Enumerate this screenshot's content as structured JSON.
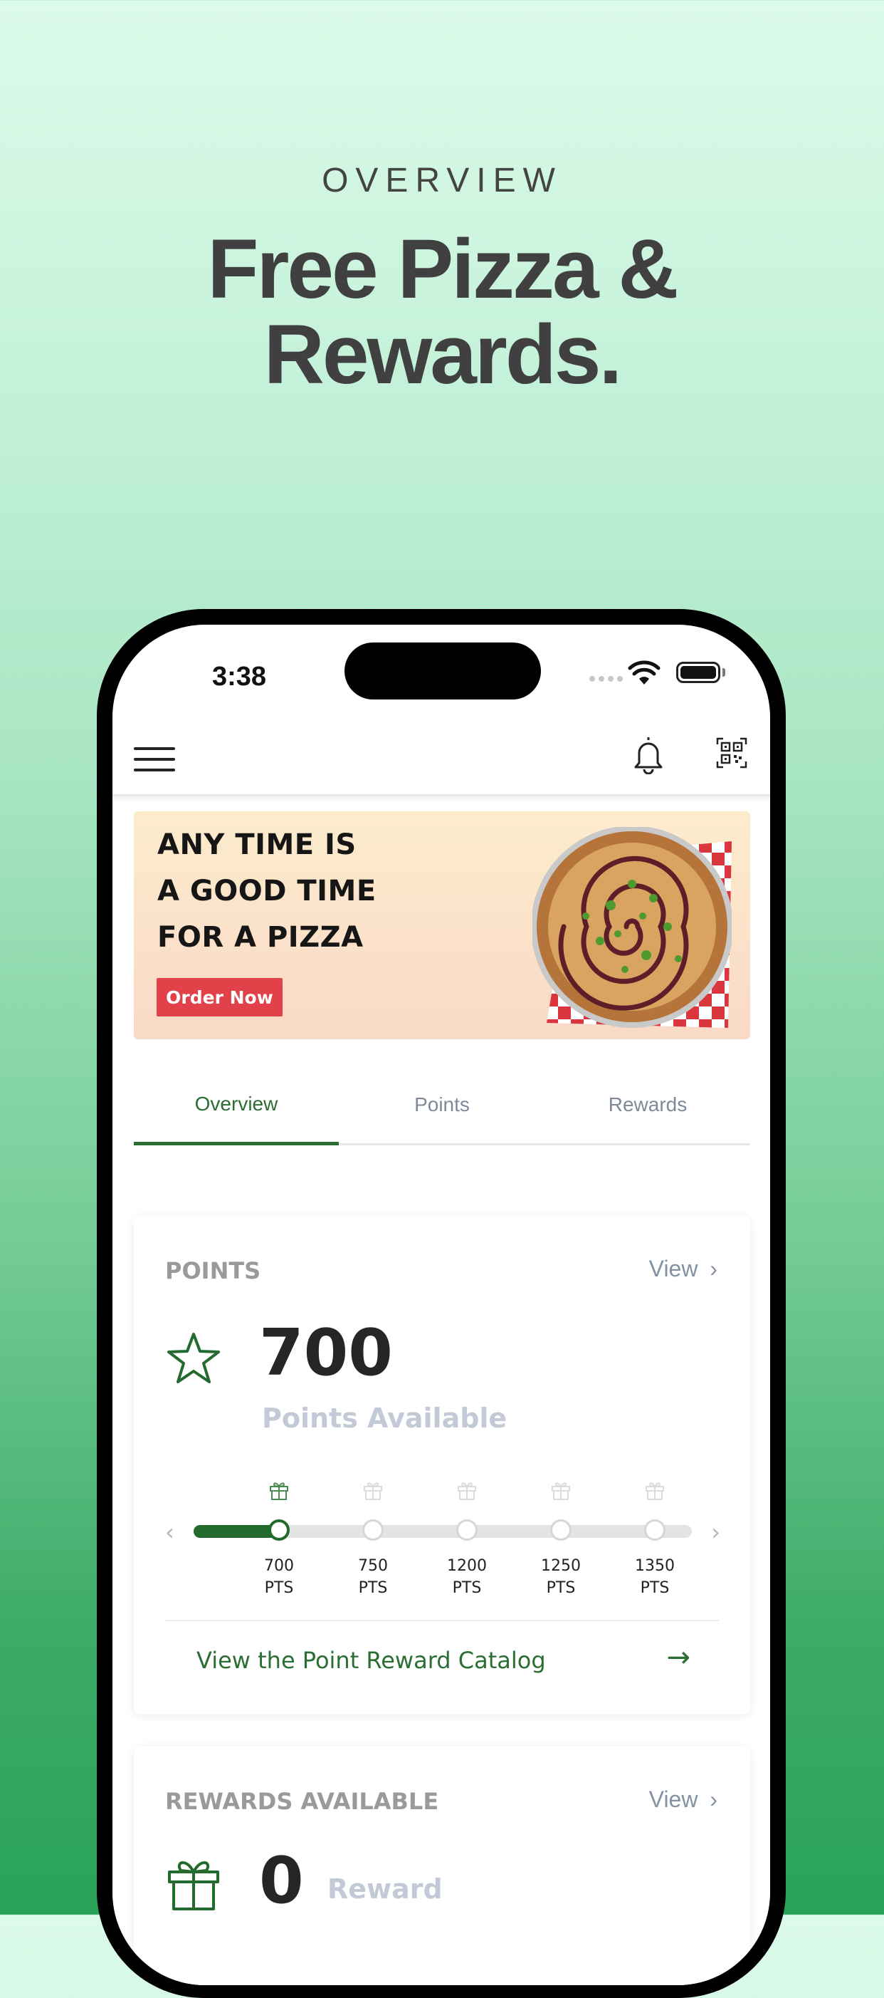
{
  "marketing": {
    "eyebrow": "OVERVIEW",
    "headline_line1": "Free Pizza &",
    "headline_line2": "Rewards."
  },
  "status_bar": {
    "time": "3:38"
  },
  "appbar": {
    "menu_icon": "hamburger-icon",
    "notification_icon": "bell-icon",
    "scan_icon": "qr-code-icon"
  },
  "banner": {
    "line1": "ANY TIME IS",
    "line2": "A GOOD TIME",
    "line3": "FOR A PIZZA",
    "cta": "Order Now"
  },
  "tabs": [
    {
      "label": "Overview",
      "active": true
    },
    {
      "label": "Points",
      "active": false
    },
    {
      "label": "Rewards",
      "active": false
    }
  ],
  "points_card": {
    "title": "POINTS",
    "view_label": "View",
    "points": "700",
    "points_label": "Points Available",
    "progress_fraction": 0.18,
    "milestones": [
      {
        "value": "700",
        "unit": "PTS",
        "reached": true
      },
      {
        "value": "750",
        "unit": "PTS",
        "reached": false
      },
      {
        "value": "1200",
        "unit": "PTS",
        "reached": false
      },
      {
        "value": "1250",
        "unit": "PTS",
        "reached": false
      },
      {
        "value": "1350",
        "unit": "PTS",
        "reached": false
      }
    ],
    "catalog_link": "View the Point Reward Catalog"
  },
  "rewards_card": {
    "title": "REWARDS AVAILABLE",
    "view_label": "View",
    "count": "0",
    "unit_label": "Reward"
  },
  "colors": {
    "accent_green": "#236a2f",
    "cta_red": "#e2414a"
  }
}
